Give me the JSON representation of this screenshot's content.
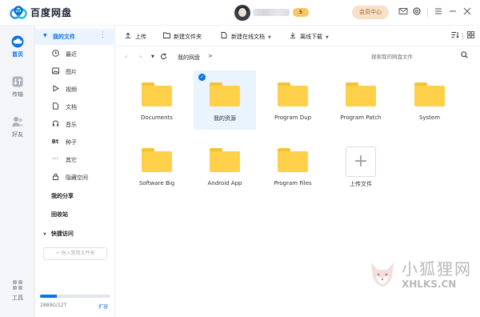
{
  "app": {
    "title": "百度网盘"
  },
  "header": {
    "vip_badge": "5",
    "member_button": "会员中心"
  },
  "leftnav": {
    "items": [
      {
        "label": "首页",
        "icon": "cloud-icon"
      },
      {
        "label": "传输",
        "icon": "transfer-icon"
      },
      {
        "label": "好友",
        "icon": "friends-icon"
      },
      {
        "label": "工具",
        "icon": "tools-icon"
      }
    ]
  },
  "sidebar": {
    "my_files": "我的文件",
    "items": [
      {
        "label": "最近",
        "icon": "clock-icon"
      },
      {
        "label": "图片",
        "icon": "image-icon"
      },
      {
        "label": "视频",
        "icon": "video-icon"
      },
      {
        "label": "文档",
        "icon": "document-icon"
      },
      {
        "label": "音乐",
        "icon": "music-icon"
      },
      {
        "label": "种子",
        "icon": "bt-icon"
      },
      {
        "label": "其它",
        "icon": "more-icon"
      },
      {
        "label": "隐藏空间",
        "icon": "lock-icon"
      }
    ],
    "my_share": "我的分享",
    "recycle_bin": "回收站",
    "quick_access": "快捷访问",
    "add_quick": "+ 拖入常用文件夹",
    "storage_text": "2889G/12T",
    "storage_fraction": 0.24,
    "expand": "扩容"
  },
  "toolbar": {
    "upload": "上传",
    "new_folder": "新建文件夹",
    "new_online_doc": "新建在线文档",
    "offline_download": "离线下载"
  },
  "address": {
    "crumb": "我的网盘",
    "separator": ">",
    "search_placeholder": "搜索我的网盘文件"
  },
  "files": [
    {
      "name": "Documents"
    },
    {
      "name": "我的资源",
      "selected": true
    },
    {
      "name": "Program Dup"
    },
    {
      "name": "Program Patch"
    },
    {
      "name": "System"
    },
    {
      "name": "Software Big"
    },
    {
      "name": "Android App"
    },
    {
      "name": "Program Files"
    }
  ],
  "upload_tile": {
    "label": "上传文件"
  },
  "watermark": {
    "cn": "小狐狸网",
    "en": "XHLKS.CN"
  }
}
